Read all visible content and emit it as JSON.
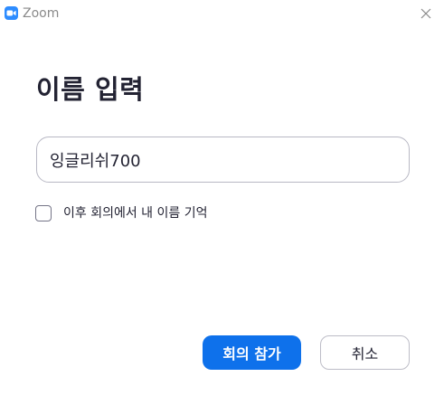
{
  "window": {
    "app_title": "Zoom",
    "app_icon": "zoom-camera-icon",
    "close_icon": "close-icon"
  },
  "dialog": {
    "heading": "이름 입력",
    "name_input": {
      "value": "잉글리쉬700",
      "placeholder": ""
    },
    "remember": {
      "label": "이후 회의에서 내 이름 기억",
      "checked": false
    },
    "join_button_label": "회의 참가",
    "cancel_button_label": "취소"
  },
  "colors": {
    "accent": "#0e71eb",
    "zoom_brand": "#2d8cff",
    "text": "#232333"
  }
}
